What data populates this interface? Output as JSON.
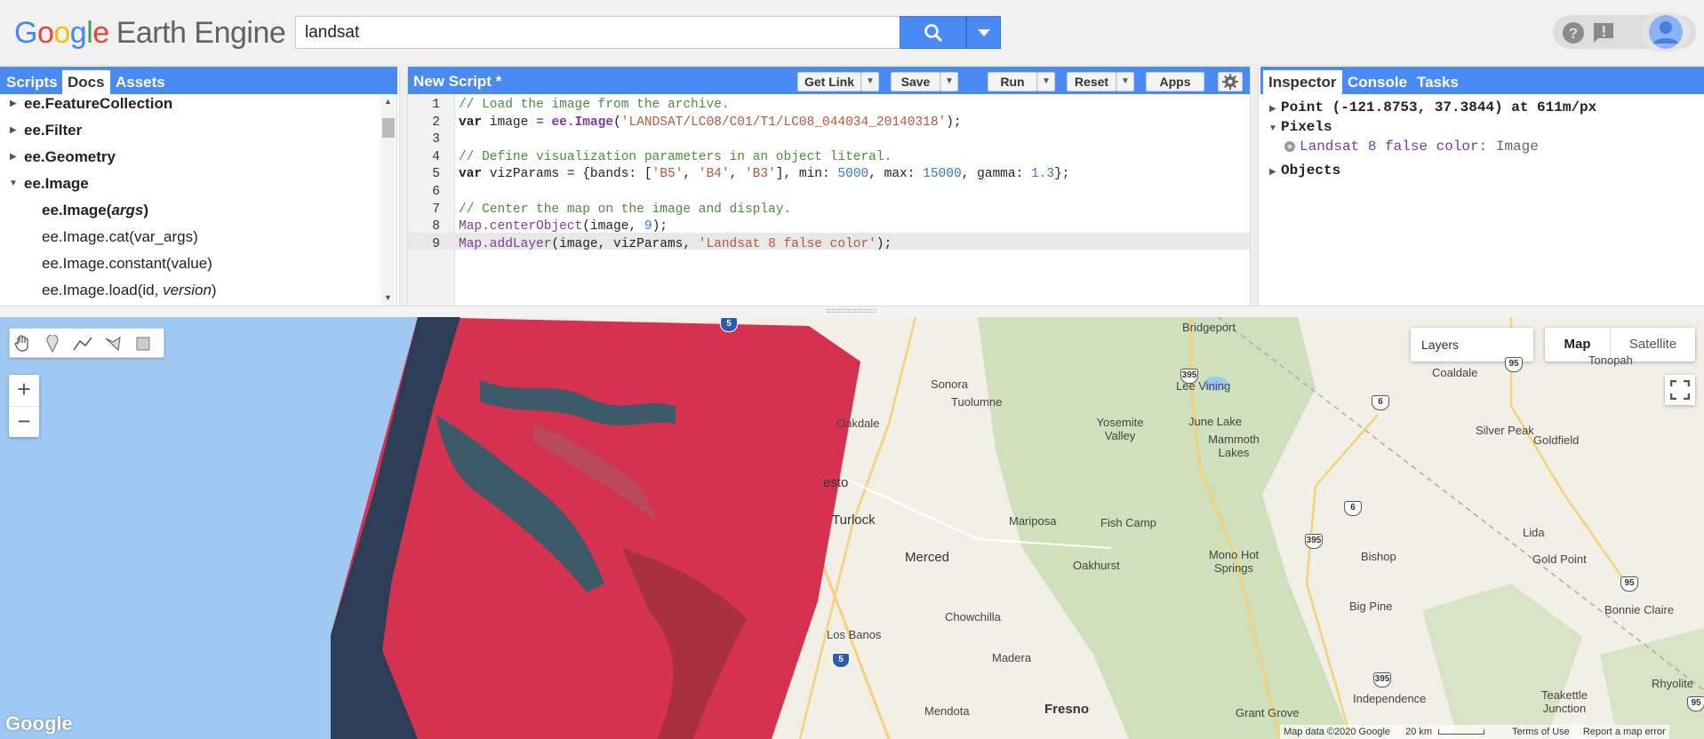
{
  "app": {
    "logo_google": "Google",
    "logo_product": "Earth Engine"
  },
  "search": {
    "value": "landsat"
  },
  "left_panel": {
    "tabs": [
      "Scripts",
      "Docs",
      "Assets"
    ],
    "active_tab": "Docs",
    "items": [
      {
        "label": "ee.FeatureCollection",
        "expanded": false
      },
      {
        "label": "ee.Filter",
        "expanded": false
      },
      {
        "label": "ee.Geometry",
        "expanded": false
      },
      {
        "label": "ee.Image",
        "expanded": true
      },
      {
        "label": "ee.Image(",
        "label_italic": "args",
        "label_end": ")",
        "bold": true
      },
      {
        "label": "ee.Image.cat(var_args)"
      },
      {
        "label": "ee.Image.constant(value)"
      },
      {
        "label": "ee.Image.load(id, ",
        "label_italic": "version",
        "label_end": ")"
      }
    ]
  },
  "editor": {
    "title": "New Script *",
    "buttons": {
      "get_link": "Get Link",
      "save": "Save",
      "run": "Run",
      "reset": "Reset",
      "apps": "Apps"
    },
    "line_numbers": [
      "1",
      "2",
      "3",
      "4",
      "5",
      "6",
      "7",
      "8",
      "9"
    ],
    "lines": [
      "// Load the image from the archive.",
      "var image = ee.Image('LANDSAT/LC08/C01/T1/LC08_044034_20140318');",
      "",
      "// Define visualization parameters in an object literal.",
      "var vizParams = {bands: ['B5', 'B4', 'B3'], min: 5000, max: 15000, gamma: 1.3};",
      "",
      "// Center the map on the image and display.",
      "Map.centerObject(image, 9);",
      "Map.addLayer(image, vizParams, 'Landsat 8 false color');"
    ]
  },
  "right_panel": {
    "tabs": [
      "Inspector",
      "Console",
      "Tasks"
    ],
    "active_tab": "Inspector",
    "point": "Point (-121.8753, 37.3844) at 611m/px",
    "pixels_label": "Pixels",
    "layer_name": "Landsat 8 false color:",
    "layer_type": "Image",
    "objects_label": "Objects"
  },
  "map": {
    "layers_label": "Layers",
    "map_button": "Map",
    "satellite_button": "Satellite",
    "zoom_in": "+",
    "zoom_out": "−",
    "cities": [
      "Bridgeport",
      "Sonora",
      "Tuolumne",
      "Lee Vining",
      "Coaldale",
      "Tonopah",
      "Oakdale",
      "Yosemite Valley",
      "June Lake",
      "Mammoth Lakes",
      "Silver Peak",
      "Goldfield",
      "esto",
      "Turlock",
      "Mariposa",
      "Fish Camp",
      "Lida",
      "Merced",
      "Oakhurst",
      "Mono Hot Springs",
      "Bishop",
      "Gold Point",
      "Chowchilla",
      "Big Pine",
      "Bonnie Claire",
      "Los Banos",
      "Madera",
      "Independence",
      "Rhyolite",
      "Mendota",
      "Fresno",
      "Grant Grove",
      "Teakettle Junction"
    ],
    "route_shields": [
      "5",
      "395",
      "95",
      "6",
      "6",
      "395",
      "95",
      "395",
      "5",
      "95"
    ],
    "footer_data": "Map data ©2020 Google",
    "scale": "20 km",
    "terms": "Terms of Use",
    "report": "Report a map error",
    "google_wordmark": "Google"
  }
}
